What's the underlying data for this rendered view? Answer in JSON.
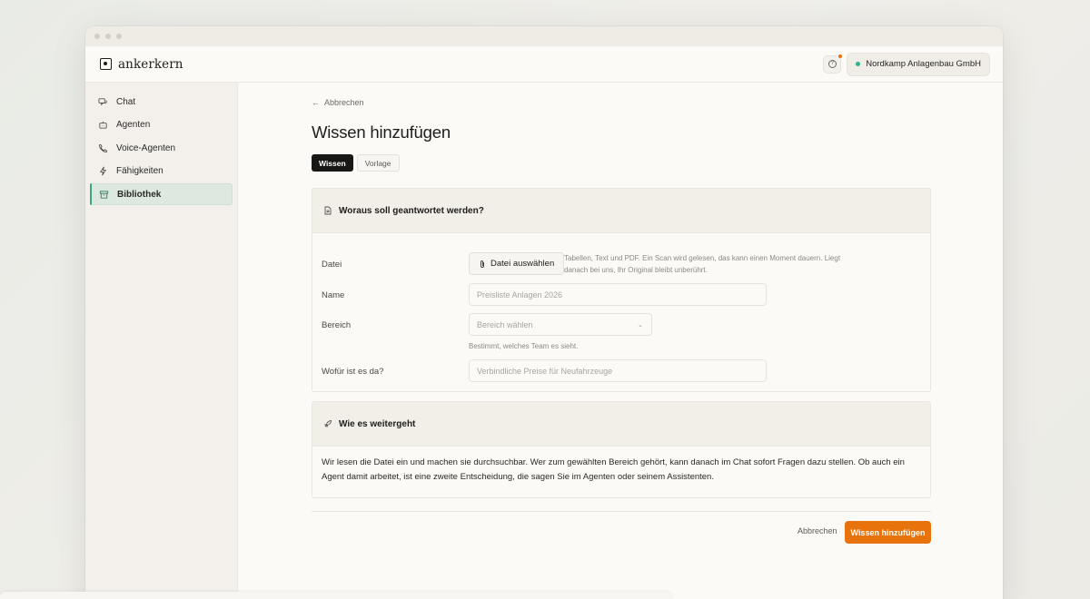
{
  "app": {
    "logo_text": "ankerkern",
    "org_name": "Nordkamp Anlagenbau GmbH",
    "accent_color": "#e8720c",
    "active_color": "#3aa77d"
  },
  "sidebar": {
    "items": [
      {
        "label": "Chat",
        "icon": "chat-icon"
      },
      {
        "label": "Agenten",
        "icon": "robot-icon"
      },
      {
        "label": "Voice-Agenten",
        "icon": "phone-icon"
      },
      {
        "label": "Fähigkeiten",
        "icon": "bolt-icon"
      },
      {
        "label": "Bibliothek",
        "icon": "archive-icon",
        "active": true
      }
    ]
  },
  "page": {
    "back_label": "Abbrechen",
    "title": "Wissen hinzufügen",
    "tabs": [
      {
        "label": "Wissen",
        "active": true
      },
      {
        "label": "Vorlage",
        "active": false
      }
    ]
  },
  "source_card": {
    "heading": "Woraus soll geantwortet werden?",
    "file_label": "Datei",
    "file_button": "Datei auswählen",
    "file_help": "Tabellen, Text und PDF. Ein Scan wird gelesen, das kann einen Moment dauern. Liegt danach bei uns, Ihr Original bleibt unberührt.",
    "name_label": "Name",
    "name_placeholder": "Preisliste Anlagen 2026",
    "area_label": "Bereich",
    "area_placeholder": "Bereich wählen",
    "area_hint": "Bestimmt, welches Team es sieht.",
    "purpose_label": "Wofür ist es da?",
    "purpose_placeholder": "Verbindliche Preise für Neufahrzeuge"
  },
  "next_card": {
    "heading": "Wie es weitergeht",
    "text": "Wir lesen die Datei ein und machen sie durchsuchbar. Wer zum gewählten Bereich gehört, kann danach im Chat sofort Fragen dazu stellen. Ob auch ein Agent damit arbeitet, ist eine zweite Entscheidung, die sagen Sie im Agenten oder seinem Assistenten."
  },
  "footer": {
    "cancel_label": "Abbrechen",
    "submit_label": "Wissen hinzufügen"
  }
}
